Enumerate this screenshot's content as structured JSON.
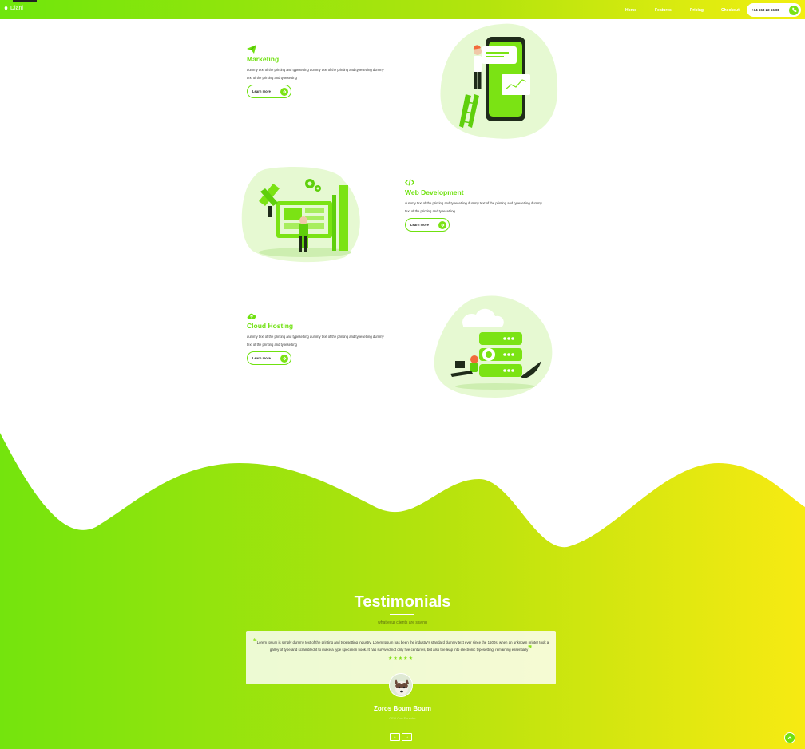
{
  "header": {
    "brand": "Diani",
    "nav": [
      {
        "label": "Home"
      },
      {
        "label": "Features"
      },
      {
        "label": "Pricing"
      },
      {
        "label": "Checkout"
      }
    ],
    "phone": "+34 663 22 66 88"
  },
  "features": [
    {
      "title": "Marketing",
      "description": "dummy text of the printing and typesetting dummy text of the printing and typesetting dummy text of the printing and typesetting",
      "button": "Learn more",
      "icon": "paper-plane-icon"
    },
    {
      "title": "Web Development",
      "description": "dummy text of the printing and typesetting dummy text of the printing and typesetting dummy text of the printing and typesetting",
      "button": "Learn more",
      "icon": "code-icon"
    },
    {
      "title": "Cloud Hosting",
      "description": "dummy text of the printing and typesetting dummy text of the printing and typesetting dummy text of the printing and typesetting",
      "button": "Learn more",
      "icon": "cloud-upload-icon"
    }
  ],
  "testimonials": {
    "title": "Testimonials",
    "subtitle": "what ecur clients are saying",
    "quote": "Lorem Ipsum is simply dummy text of the printing and typesetting industry. Lorem Ipsum has been the industry's standard dummy text ever since the 1500s, when an unknown printer took a galley of type and scrambled it to make a type specimen book. It has survived not only five centuries, but also the leap into electronic typesetting, remaining essentially",
    "stars": "★★★★★",
    "rating": 5,
    "name": "Zoros Boum Boum",
    "role": "CEO Con Founder",
    "prev": "←",
    "next": "→"
  },
  "colors": {
    "accent": "#6fe10f",
    "gradient_start": "#6fe60c",
    "gradient_end": "#f7ea12",
    "blob": "#e6f9d2"
  }
}
